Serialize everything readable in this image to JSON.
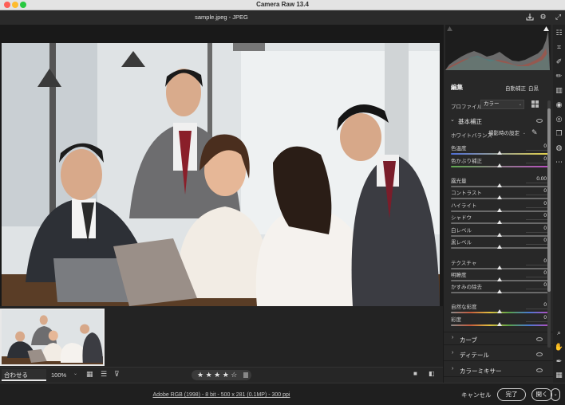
{
  "window": {
    "title": "Camera Raw 13.4"
  },
  "document": {
    "file_title": "sample.jpeg  -  JPEG"
  },
  "panel": {
    "edit_title": "編集",
    "auto_label": "自動補正",
    "bw_label": "白黒",
    "profile_label": "プロファイル",
    "profile_value": "カラー",
    "basic_title": "基本補正",
    "wb_label": "ホワイトバランス",
    "wb_value": "撮影時の設定",
    "sliders": [
      {
        "label": "色温度",
        "value": "0"
      },
      {
        "label": "色かぶり補正",
        "value": "0"
      },
      {
        "label": "露光量",
        "value": "0.00"
      },
      {
        "label": "コントラスト",
        "value": "0"
      },
      {
        "label": "ハイライト",
        "value": "0"
      },
      {
        "label": "シャドウ",
        "value": "0"
      },
      {
        "label": "白レベル",
        "value": "0"
      },
      {
        "label": "黒レベル",
        "value": "0"
      },
      {
        "label": "テクスチャ",
        "value": "0"
      },
      {
        "label": "明瞭度",
        "value": "0"
      },
      {
        "label": "かすみの除去",
        "value": "0"
      },
      {
        "label": "自然な彩度",
        "value": "0"
      },
      {
        "label": "彩度",
        "value": "0"
      }
    ],
    "collapsed_sections": [
      "カーブ",
      "ディテール",
      "カラーミキサー"
    ]
  },
  "bottombar": {
    "zoom_fit": "合わせる (220%)",
    "zoom_pct": "100%",
    "rating_stars": "★ ★ ★ ★ ☆"
  },
  "footer": {
    "info_link": "Adobe RGB (1998) - 8 bit - 500 x 281 (0.1MP) - 300 ppi",
    "cancel": "キャンセル",
    "done": "完了",
    "open": "開く"
  },
  "colors": {
    "accent_slider_temp": "#4f6fd8",
    "accent_slider_tint": "#5fa94f"
  },
  "icons": [
    "save-icon",
    "gear-icon",
    "fullscreen-icon",
    "edit-icon",
    "crop-icon",
    "healing-icon",
    "brush-icon",
    "gradient-icon",
    "radial-icon",
    "redeye-icon",
    "presets-icon",
    "snapshot-icon",
    "more-icon",
    "zoom-icon",
    "hand-icon",
    "sampler-icon",
    "grid-icon"
  ]
}
